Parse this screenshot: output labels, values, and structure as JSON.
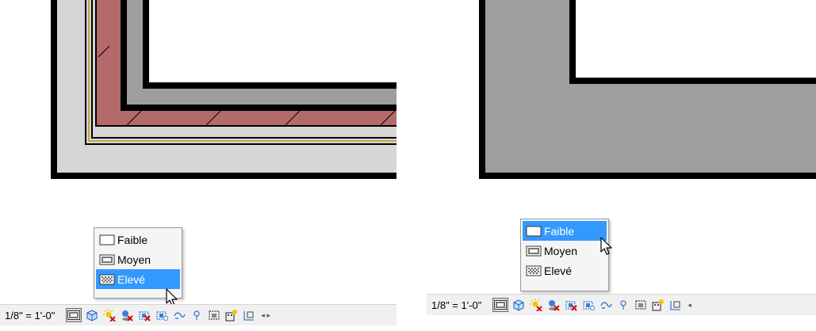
{
  "left": {
    "scale_label": "1/8\" = 1'-0\"",
    "menu": {
      "items": [
        {
          "label": "Faible",
          "icon": "detail-coarse-icon",
          "selected": false
        },
        {
          "label": "Moyen",
          "icon": "detail-medium-icon",
          "selected": false
        },
        {
          "label": "Elevé",
          "icon": "detail-fine-icon",
          "selected": true
        }
      ]
    }
  },
  "right": {
    "scale_label": "1/8\" = 1'-0\"",
    "menu": {
      "items": [
        {
          "label": "Faible",
          "icon": "detail-coarse-icon",
          "selected": true
        },
        {
          "label": "Moyen",
          "icon": "detail-medium-icon",
          "selected": false
        },
        {
          "label": "Elevé",
          "icon": "detail-fine-icon",
          "selected": false
        }
      ]
    }
  },
  "colors": {
    "selection": "#3399ff",
    "wall_gray": "#9e9e9e",
    "insulation_red": "#b4696b",
    "finish_light_gray": "#d6d6d6"
  }
}
